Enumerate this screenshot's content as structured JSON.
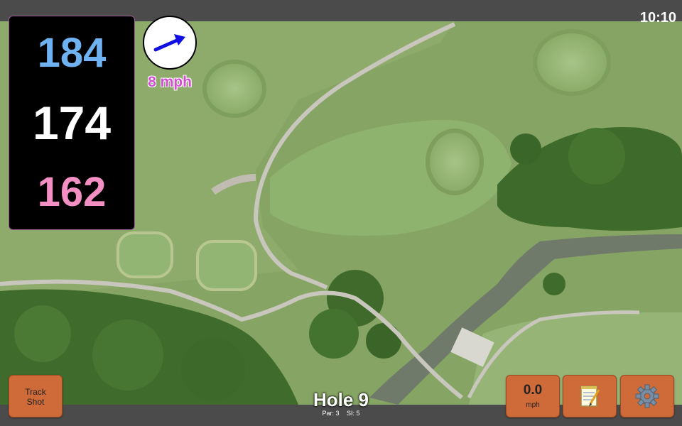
{
  "status_bar": {
    "time": "10:10"
  },
  "yardage": {
    "back": "184",
    "middle": "174",
    "front": "162"
  },
  "wind": {
    "speed_label": "8 mph",
    "arrow_color": "#1010e0"
  },
  "buttons": {
    "track_shot_line1": "Track",
    "track_shot_line2": "Shot",
    "speed_value": "0.0",
    "speed_unit": "mph",
    "notes_icon": "notepad-icon",
    "settings_icon": "gear-icon"
  },
  "hole": {
    "title": "Hole 9",
    "par": "Par: 3",
    "si": "SI: 5"
  },
  "colors": {
    "back_yardage": "#6fb2f2",
    "middle_yardage": "#ffffff",
    "front_yardage": "#f48fc4",
    "button": "#cf6a39",
    "wind_text": "#d24fd2"
  }
}
